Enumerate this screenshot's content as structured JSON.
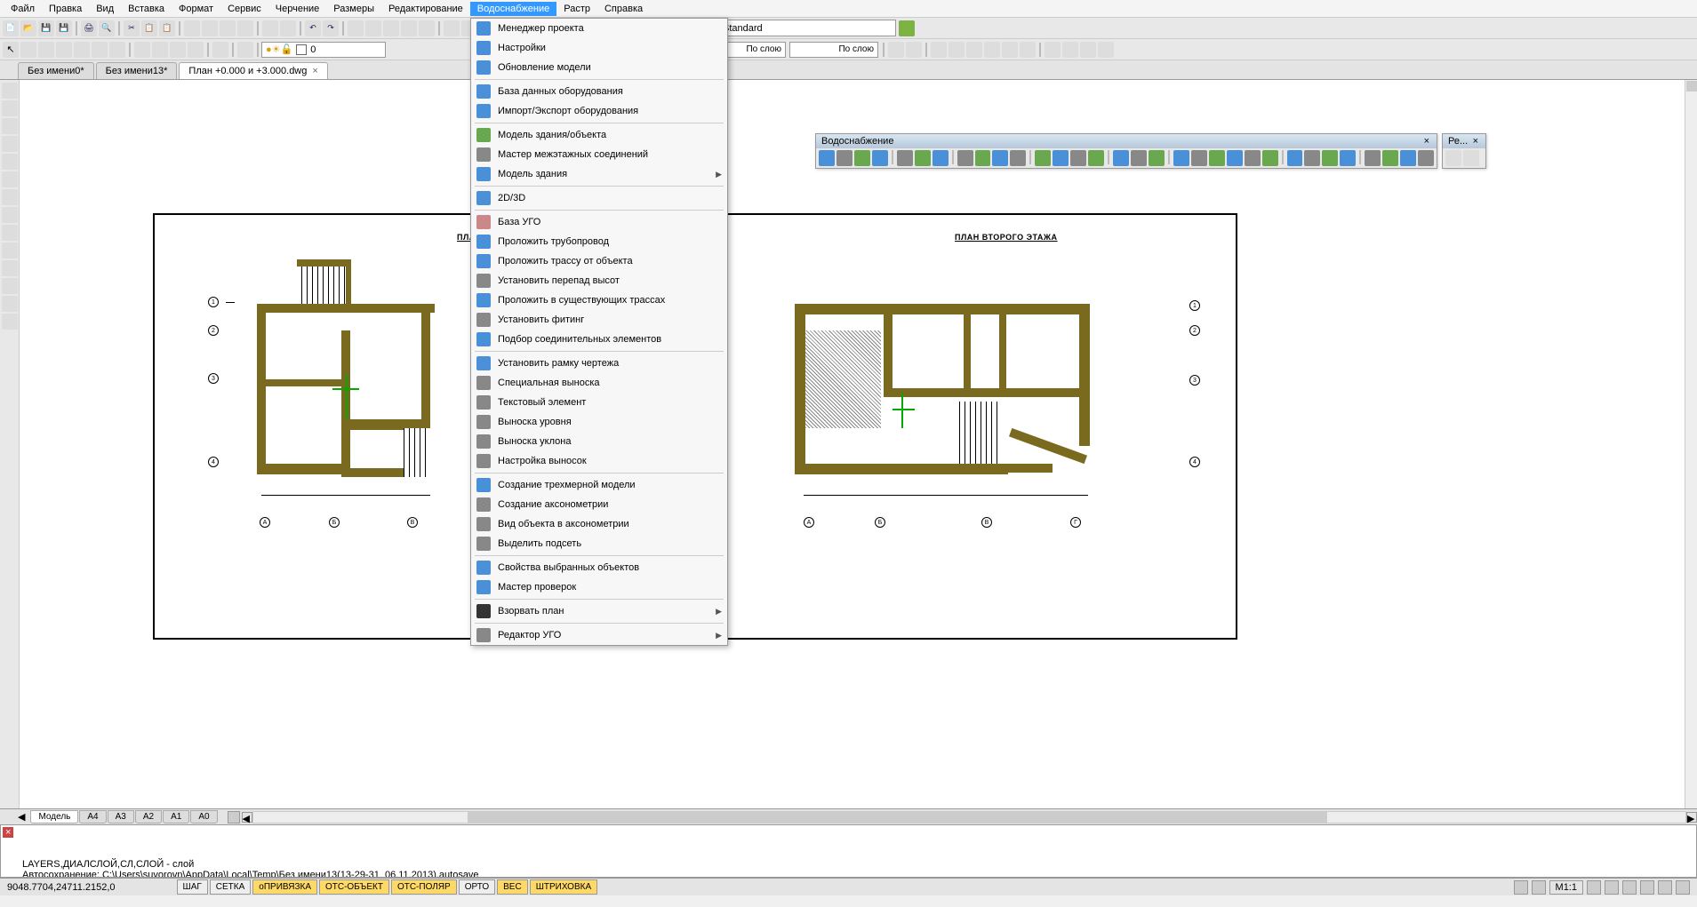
{
  "menu": [
    "Файл",
    "Правка",
    "Вид",
    "Вставка",
    "Формат",
    "Сервис",
    "Черчение",
    "Размеры",
    "Редактирование",
    "Водоснабжение",
    "Растр",
    "Справка"
  ],
  "menu_active": 9,
  "toolbar2_combo1": "Standard",
  "toolbar3_layer": "0",
  "toolbar3_line1": "По слою",
  "toolbar3_line2": "По слою",
  "tabs": [
    "Без имени0*",
    "Без имени13*",
    "План +0.000 и +3.000.dwg"
  ],
  "tabs_active": 2,
  "dropdown": [
    {
      "label": "Менеджер проекта",
      "icon": "#4a90d9"
    },
    {
      "label": "Настройки",
      "icon": "#4a90d9"
    },
    {
      "label": "Обновление модели",
      "icon": "#4a90d9"
    },
    {
      "sep": true
    },
    {
      "label": "База данных оборудования",
      "icon": "#4a90d9"
    },
    {
      "label": "Импорт/Экспорт оборудования",
      "icon": "#4a90d9"
    },
    {
      "sep": true
    },
    {
      "label": "Модель здания/объекта",
      "icon": "#6aa84f"
    },
    {
      "label": "Мастер межэтажных соединений",
      "icon": "#888"
    },
    {
      "label": "Модель здания",
      "icon": "#4a90d9",
      "sub": true
    },
    {
      "sep": true
    },
    {
      "label": "2D/3D",
      "icon": "#4a90d9"
    },
    {
      "sep": true
    },
    {
      "label": "База УГО",
      "icon": "#c88"
    },
    {
      "label": "Проложить трубопровод",
      "icon": "#4a90d9"
    },
    {
      "label": "Проложить трассу от объекта",
      "icon": "#4a90d9"
    },
    {
      "label": "Установить перепад высот",
      "icon": "#888"
    },
    {
      "label": "Проложить в существующих трассах",
      "icon": "#4a90d9"
    },
    {
      "label": "Установить фитинг",
      "icon": "#888"
    },
    {
      "label": "Подбор соединительных элементов",
      "icon": "#4a90d9"
    },
    {
      "sep": true
    },
    {
      "label": "Установить рамку чертежа",
      "icon": "#4a90d9"
    },
    {
      "label": "Специальная выноска",
      "icon": "#888"
    },
    {
      "label": "Текстовый элемент",
      "icon": "#888"
    },
    {
      "label": "Выноска уровня",
      "icon": "#888"
    },
    {
      "label": "Выноска уклона",
      "icon": "#888"
    },
    {
      "label": "Настройка выносок",
      "icon": "#888"
    },
    {
      "sep": true
    },
    {
      "label": "Создание трехмерной модели",
      "icon": "#4a90d9"
    },
    {
      "label": "Создание аксонометрии",
      "icon": "#888"
    },
    {
      "label": "Вид объекта в аксонометрии",
      "icon": "#888"
    },
    {
      "label": "Выделить подсеть",
      "icon": "#888"
    },
    {
      "sep": true
    },
    {
      "label": "Свойства выбранных объектов",
      "icon": "#4a90d9"
    },
    {
      "label": "Мастер проверок",
      "icon": "#4a90d9"
    },
    {
      "sep": true
    },
    {
      "label": "Взорвать план",
      "icon": "#333",
      "sub": true
    },
    {
      "sep": true
    },
    {
      "label": "Редактор УГО",
      "icon": "#888",
      "sub": true
    }
  ],
  "float_tb1_title": "Водоснабжение",
  "float_tb2_title": "Ре...",
  "plan1_title": "ПЛАН ПЕРВОГО ЭТАЖА",
  "plan2_title": "ПЛАН ВТОРОГО ЭТАЖА",
  "bottom_tabs": [
    "Модель",
    "А4",
    "А3",
    "А2",
    "А1",
    "А0"
  ],
  "bottom_tabs_active": 0,
  "cmd_lines": "LAYERS,ДИАЛСЛОЙ,СЛ,СЛОЙ - слой\nАвтосохранение: C:\\Users\\suvorovn\\AppData\\Local\\Temp\\Без имени13(13-29-31_06.11.2013).autosave\nCLOSE,ЗАКРЫТЬ - Закрыть\nКоманда:",
  "status_coord": "9048.7704,24711.2152,0",
  "status_toggles": [
    {
      "label": "ШАГ",
      "on": false
    },
    {
      "label": "СЕТКА",
      "on": false
    },
    {
      "label": "оПРИВЯЗКА",
      "on": true
    },
    {
      "label": "ОТС-ОБЪЕКТ",
      "on": true
    },
    {
      "label": "ОТС-ПОЛЯР",
      "on": true
    },
    {
      "label": "ОРТО",
      "on": false
    },
    {
      "label": "ВЕС",
      "on": true
    },
    {
      "label": "ШТРИХОВКА",
      "on": true
    }
  ],
  "status_scale": "М1:1"
}
